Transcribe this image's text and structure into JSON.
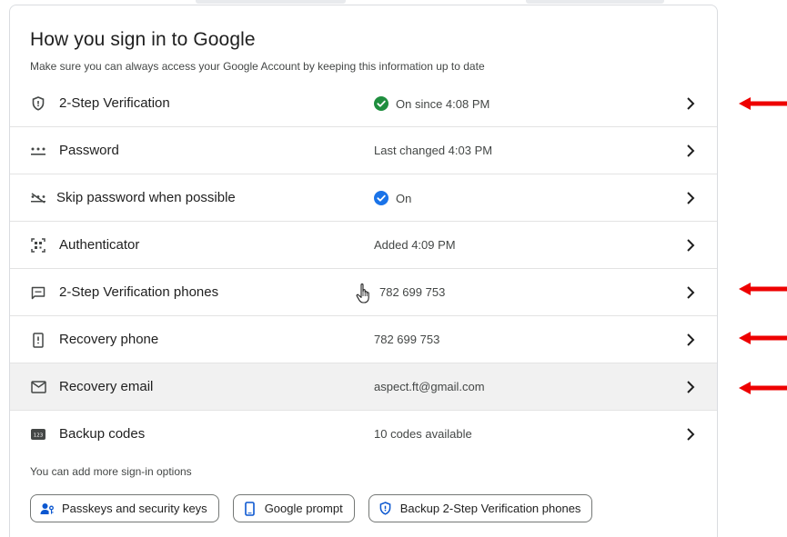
{
  "header": {
    "title": "How you sign in to Google",
    "subtitle": "Make sure you can always access your Google Account by keeping this information up to date"
  },
  "rows": [
    {
      "icon": "shield-icon",
      "label": "2-Step Verification",
      "value": "On since 4:08 PM",
      "status": "green-check"
    },
    {
      "icon": "password-dots-icon",
      "label": "Password",
      "value": "Last changed 4:03 PM"
    },
    {
      "icon": "skip-password-icon",
      "label": "Skip password when possible",
      "value": "On",
      "status": "blue-check"
    },
    {
      "icon": "authenticator-icon",
      "label": "Authenticator",
      "value": "Added 4:09 PM"
    },
    {
      "icon": "message-icon",
      "label": "2-Step Verification phones",
      "value": "782 699 753"
    },
    {
      "icon": "phone-icon",
      "label": "Recovery phone",
      "value": "782 699 753"
    },
    {
      "icon": "mail-icon",
      "label": "Recovery email",
      "value": "aspect.ft@gmail.com"
    },
    {
      "icon": "backup-codes-icon",
      "label": "Backup codes",
      "value": "10 codes available"
    }
  ],
  "more_options": {
    "text": "You can add more sign-in options",
    "chips": [
      {
        "icon": "passkey-icon",
        "label": "Passkeys and security keys"
      },
      {
        "icon": "device-icon",
        "label": "Google prompt"
      },
      {
        "icon": "shield-icon",
        "label": "Backup 2-Step Verification phones"
      }
    ]
  },
  "colors": {
    "accent_green": "#1e8e3e",
    "accent_blue": "#1a73e8",
    "annotation_red": "#ee0000"
  }
}
